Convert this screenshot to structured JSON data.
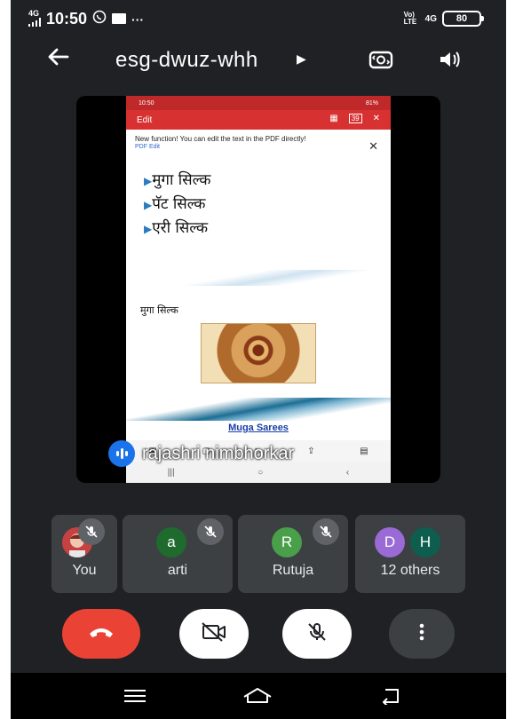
{
  "status_bar": {
    "network": "4G",
    "time": "10:50",
    "right_network": "4G",
    "right_volte": "Vo) LTE",
    "battery": "80",
    "icons": [
      "signal-icon",
      "whatsapp-icon",
      "message-icon",
      "more-dots-icon",
      "battery-icon"
    ]
  },
  "header": {
    "meeting_code": "esg-dwuz-whh",
    "icons": [
      "back-arrow-icon",
      "chevron-right-icon",
      "switch-camera-icon",
      "speaker-icon"
    ]
  },
  "shared_screen": {
    "status_time": "10:50",
    "status_battery": "81%",
    "toolbar_title": "Edit",
    "toolbar_page": "39",
    "notice_text": "New function! You can edit the text in the PDF directly!",
    "notice_link": "PDF Edit",
    "slide1_bullets": [
      "मुगा सिल्क",
      "पॅट सिल्क",
      "एरी सिल्क"
    ],
    "slide2_title": "मुगा सिल्क",
    "link_text": "Muga Sarees",
    "presenter_name": "rajashri nimbhorkar",
    "accent": "#d83131"
  },
  "participants": [
    {
      "name": "You",
      "initial": "",
      "color": "#c64141",
      "muted": true
    },
    {
      "name": "arti",
      "initial": "a",
      "color": "#1e6b2d",
      "muted": true
    },
    {
      "name": "Rutuja",
      "initial": "R",
      "color": "#4aa04a",
      "muted": true
    },
    {
      "name": "12 others",
      "initials": [
        "D",
        "H"
      ],
      "colors": [
        "#9a6ad6",
        "#0d5e4e"
      ],
      "muted": false
    }
  ],
  "controls": {
    "colors": {
      "end_call": "#ea4335",
      "toggle": "#ffffff",
      "more": "#3c4043"
    },
    "icons": [
      "end-call-icon",
      "camera-off-icon",
      "mic-off-icon",
      "more-vertical-icon"
    ]
  },
  "navigation": {
    "icons": [
      "menu-icon",
      "home-icon",
      "back-icon"
    ]
  }
}
